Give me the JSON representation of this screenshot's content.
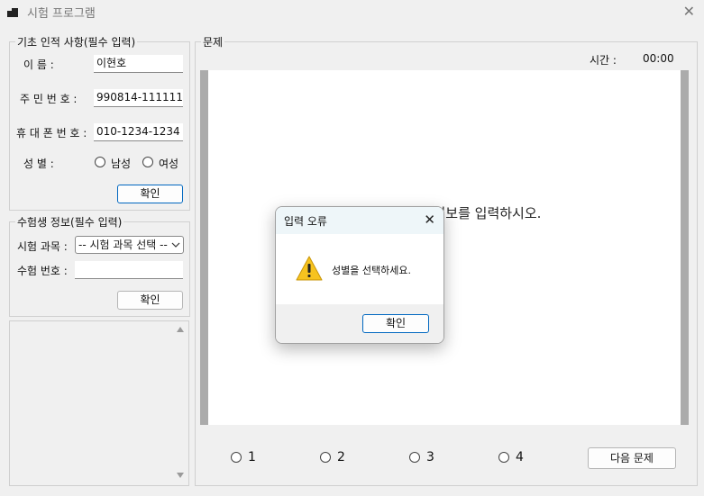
{
  "window": {
    "title": "시험 프로그램",
    "close_glyph": "✕"
  },
  "basic_info": {
    "legend": "기초 인적 사항(필수 입력)",
    "name_label": "이     름 :",
    "name_value": "이현호",
    "ssn_label": "주 민 번 호 :",
    "ssn_value": "990814-1111111",
    "phone_label": "휴 대 폰  번 호 :",
    "phone_value": "010-1234-1234",
    "gender_label": "성     별 :",
    "gender_male": "남성",
    "gender_female": "여성",
    "confirm_label": "확인"
  },
  "exam_info": {
    "legend": "수험생 정보(필수 입력)",
    "subject_label": "시험 과목 :",
    "subject_selected": "-- 시험 과목 선택 --",
    "exam_no_label": "수험 번호 :",
    "exam_no_value": "",
    "confirm_label": "확인"
  },
  "question": {
    "legend": "문제",
    "time_label": "시간 :",
    "time_value": "00:00",
    "prompt": "시험 과목 및 수험생 정보를 입력하시오.",
    "options": [
      "1",
      "2",
      "3",
      "4"
    ],
    "next_label": "다음 문제"
  },
  "dialog": {
    "title": "입력 오류",
    "message": "성별을 선택하세요.",
    "ok_label": "확인",
    "icon": "warning-icon",
    "close_glyph": "✕"
  }
}
